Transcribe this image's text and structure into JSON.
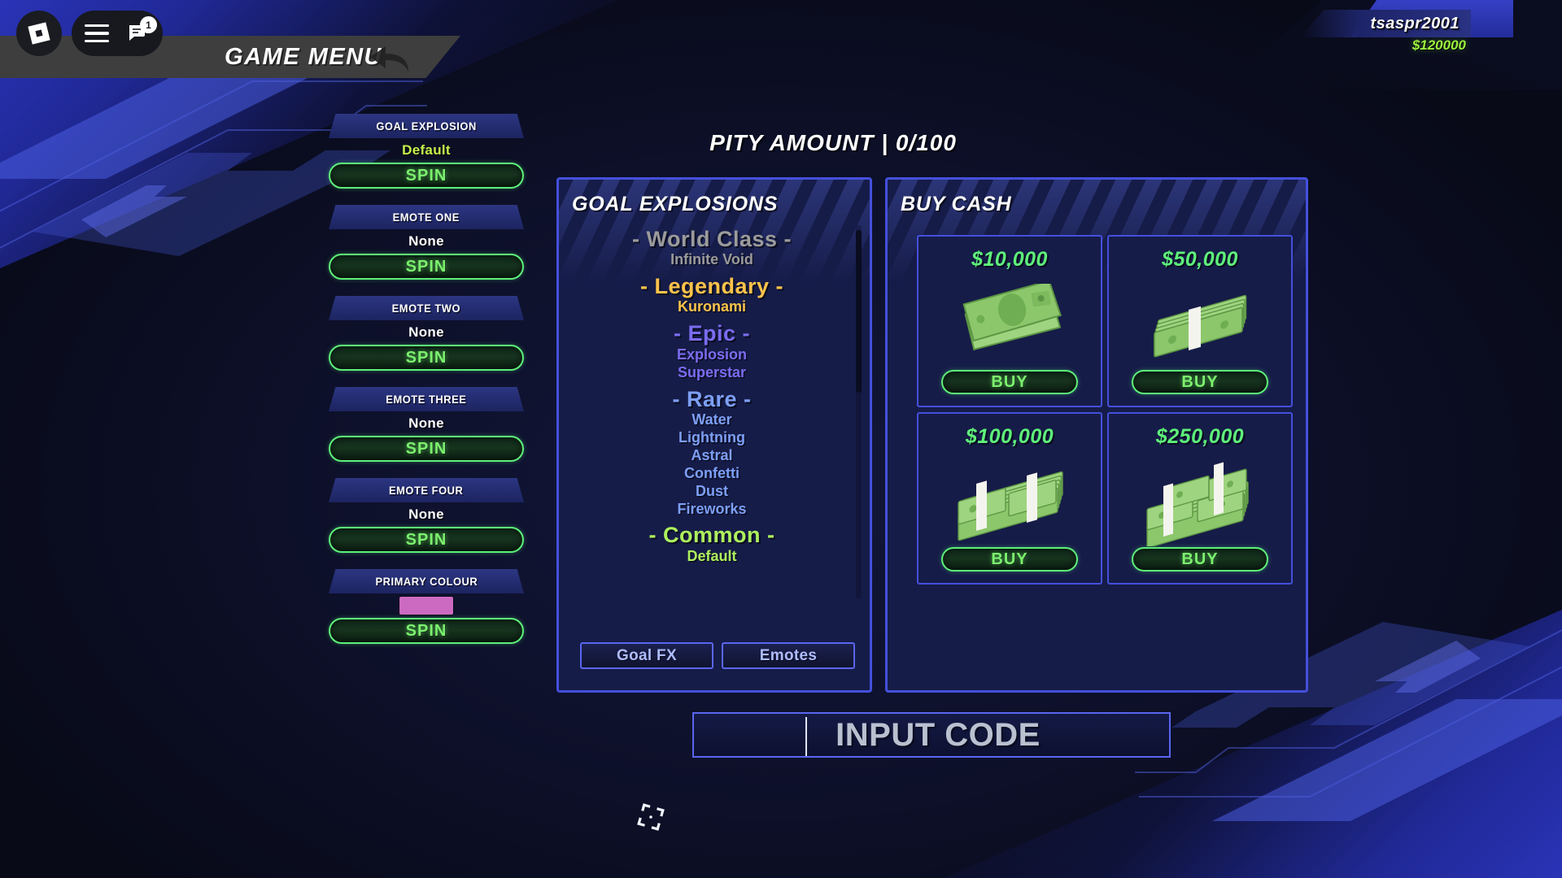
{
  "roblox_bar": {
    "logo_icon": "roblox-logo-icon",
    "menu_icon": "hamburger-menu-icon",
    "chat_icon": "chat-icon",
    "chat_badge_count": "1"
  },
  "header": {
    "title": "GAME MENU",
    "back_icon": "back-arrow-icon"
  },
  "player": {
    "username": "tsaspr2001",
    "cash": "$120000"
  },
  "pity": {
    "label": "PITY AMOUNT | 0/100"
  },
  "sidebar": {
    "slots": [
      {
        "title": "GOAL EXPLOSION",
        "value": "Default",
        "value_style": "green",
        "button": "SPIN"
      },
      {
        "title": "EMOTE ONE",
        "value": "None",
        "value_style": "white",
        "button": "SPIN"
      },
      {
        "title": "EMOTE TWO",
        "value": "None",
        "value_style": "white",
        "button": "SPIN"
      },
      {
        "title": "EMOTE THREE",
        "value": "None",
        "value_style": "white",
        "button": "SPIN"
      },
      {
        "title": "EMOTE FOUR",
        "value": "None",
        "value_style": "white",
        "button": "SPIN"
      },
      {
        "title": "PRIMARY COLOUR",
        "value": "",
        "value_style": "swatch",
        "swatch_color": "#cc6ac2",
        "button": "SPIN"
      }
    ]
  },
  "goal_explosions": {
    "title": "GOAL EXPLOSIONS",
    "groups": [
      {
        "rarity": "- World Class -",
        "color": "#9b9b9b",
        "items": [
          "Infinite Void"
        ],
        "item_color": "#9b9b9b"
      },
      {
        "rarity": "- Legendary -",
        "color": "#fcc34a",
        "items": [
          "Kuronami"
        ],
        "item_color": "#fcc34a"
      },
      {
        "rarity": "- Epic -",
        "color": "#7b6cf0",
        "items": [
          "Explosion",
          "Superstar"
        ],
        "item_color": "#7b6cf0"
      },
      {
        "rarity": "- Rare -",
        "color": "#7d9ff5",
        "items": [
          "Water",
          "Lightning",
          "Astral",
          "Confetti",
          "Dust",
          "Fireworks"
        ],
        "item_color": "#7d9ff5"
      },
      {
        "rarity": "- Common -",
        "color": "#aef05e",
        "items": [
          "Default"
        ],
        "item_color": "#aef05e"
      }
    ],
    "tabs": [
      {
        "label": "Goal FX"
      },
      {
        "label": "Emotes"
      }
    ]
  },
  "buy_cash": {
    "title": "BUY CASH",
    "tiles": [
      {
        "amount": "$10,000",
        "art": "single-bill-icon",
        "button": "BUY"
      },
      {
        "amount": "$50,000",
        "art": "cash-bundle-icon",
        "button": "BUY"
      },
      {
        "amount": "$100,000",
        "art": "cash-stack-icon",
        "button": "BUY"
      },
      {
        "amount": "$250,000",
        "art": "cash-pile-icon",
        "button": "BUY"
      }
    ]
  },
  "code_input": {
    "placeholder": "INPUT CODE",
    "value": ""
  },
  "cursor": {
    "icon": "crosshair-cursor-icon"
  },
  "colors": {
    "accent_green": "#5ef07a",
    "accent_blue": "#4450dc",
    "panel_bg": "#161c48",
    "page_bg": "#0b0e1e"
  }
}
